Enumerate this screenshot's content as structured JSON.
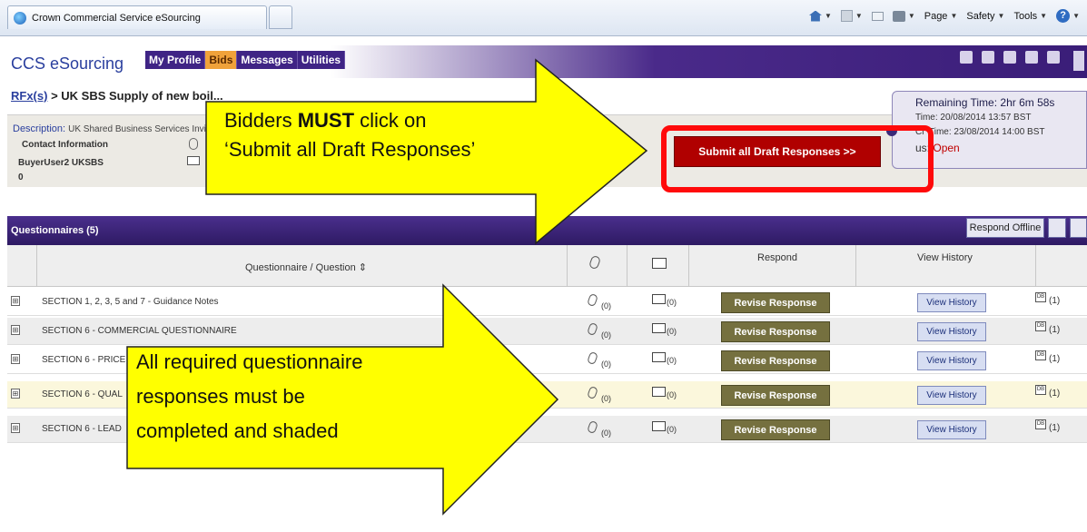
{
  "browser": {
    "tab_title": "Crown Commercial Service eSourcing",
    "commands": {
      "page": "Page",
      "safety": "Safety",
      "tools": "Tools"
    }
  },
  "app": {
    "brand": "CCS eSourcing",
    "nav": [
      "My Profile",
      "Bids",
      "Messages",
      "Utilities"
    ],
    "active_nav": "Bids"
  },
  "breadcrumb": {
    "link": "RFx(s)",
    "rest": " > UK SBS Supply of new boil..."
  },
  "description": {
    "label": "Description:",
    "value": "UK Shared Business Services Invi",
    "contact_label": "Contact Information",
    "buyer": "BuyerUser2 UKSBS",
    "zero": "0"
  },
  "timing": {
    "remaining_label": "Remaining Time:",
    "remaining_value": "2hr 6m 58s",
    "open_time": "Time: 20/08/2014 13:57 BST",
    "close_time": "Time: 23/08/2014 14:00 BST",
    "status_label": "us:",
    "status_value": "Open",
    "cl_prefix": "Cl"
  },
  "submit_button": "Submit all Draft Responses >>",
  "callouts": {
    "top_line1_prefix": "Bidders ",
    "top_line1_bold": "MUST",
    "top_line1_suffix": " click on",
    "top_line2": "‘Submit all Draft Responses’",
    "bottom_line1": "All required questionnaire",
    "bottom_line2": "responses must be",
    "bottom_line3": "completed and shaded"
  },
  "questionnaires": {
    "title": "Questionnaires (5)",
    "respond_offline": "Respond Offline",
    "headers": {
      "question": "Questionnaire / Question",
      "respond": "Respond",
      "history": "View History"
    },
    "rows": [
      {
        "text": "SECTION 1, 2, 3, 5 and 7 - Guidance Notes",
        "clip": "(0)",
        "env": "(0)",
        "respond": "Revise Response",
        "history": "View History",
        "db": "(1)"
      },
      {
        "text": "SECTION 6 - COMMERCIAL QUESTIONNAIRE",
        "clip": "(0)",
        "env": "(0)",
        "respond": "Revise Response",
        "history": "View History",
        "db": "(1)"
      },
      {
        "text": "SECTION 6 - PRICE",
        "clip": "(0)",
        "env": "(0)",
        "respond": "Revise Response",
        "history": "View History",
        "db": "(1)"
      },
      {
        "text": "SECTION 6 - QUAL",
        "clip": "(0)",
        "env": "(0)",
        "respond": "Revise Response",
        "history": "View History",
        "db": "(1)"
      },
      {
        "text": "SECTION 6 - LEAD",
        "clip": "(0)",
        "env": "(0)",
        "respond": "Revise Response",
        "history": "View History",
        "db": "(1)"
      }
    ]
  },
  "colors": {
    "header_purple": "#3f2485",
    "bids_orange": "#f0a23a",
    "submit_red": "#b00000",
    "highlight_frame": "#ff0a0a",
    "callout_yellow": "#ffff00",
    "revise_olive": "#75703f"
  }
}
